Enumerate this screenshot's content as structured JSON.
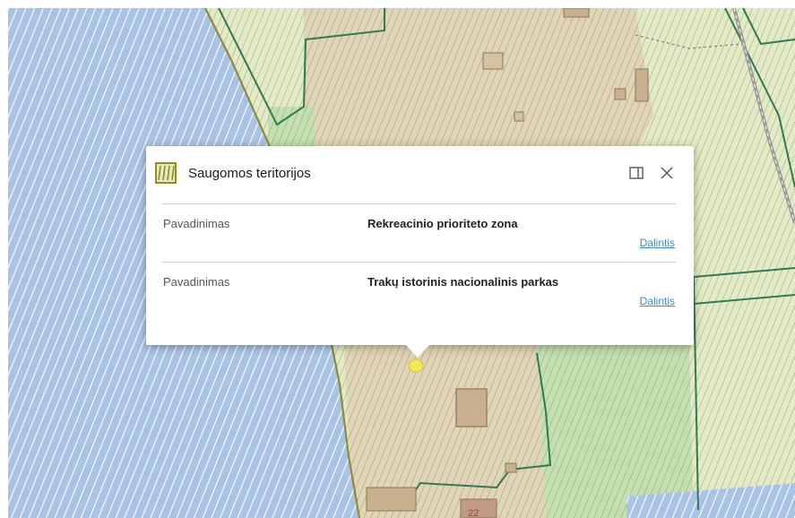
{
  "popup": {
    "title": "Saugomos teritorijos",
    "icon": "protected-area-layer-icon",
    "maximize_icon": "maximize-icon",
    "close_icon": "close-icon",
    "rows": [
      {
        "label": "Pavadinimas",
        "value": "Rekreacinio prioriteto zona",
        "link": "Dalintis"
      },
      {
        "label": "Pavadinimas",
        "value": "Trakų istorinis nacionalinis parkas",
        "link": "Dalintis"
      }
    ]
  },
  "map": {
    "map_labels": [
      "22"
    ],
    "colors": {
      "water": "#a9c3e6",
      "land": "#e3ebc6",
      "park": "#c4e0b0",
      "sand": "#e0d2b4",
      "boundary": "#2f7a52",
      "selection": "#f5e65a"
    }
  }
}
